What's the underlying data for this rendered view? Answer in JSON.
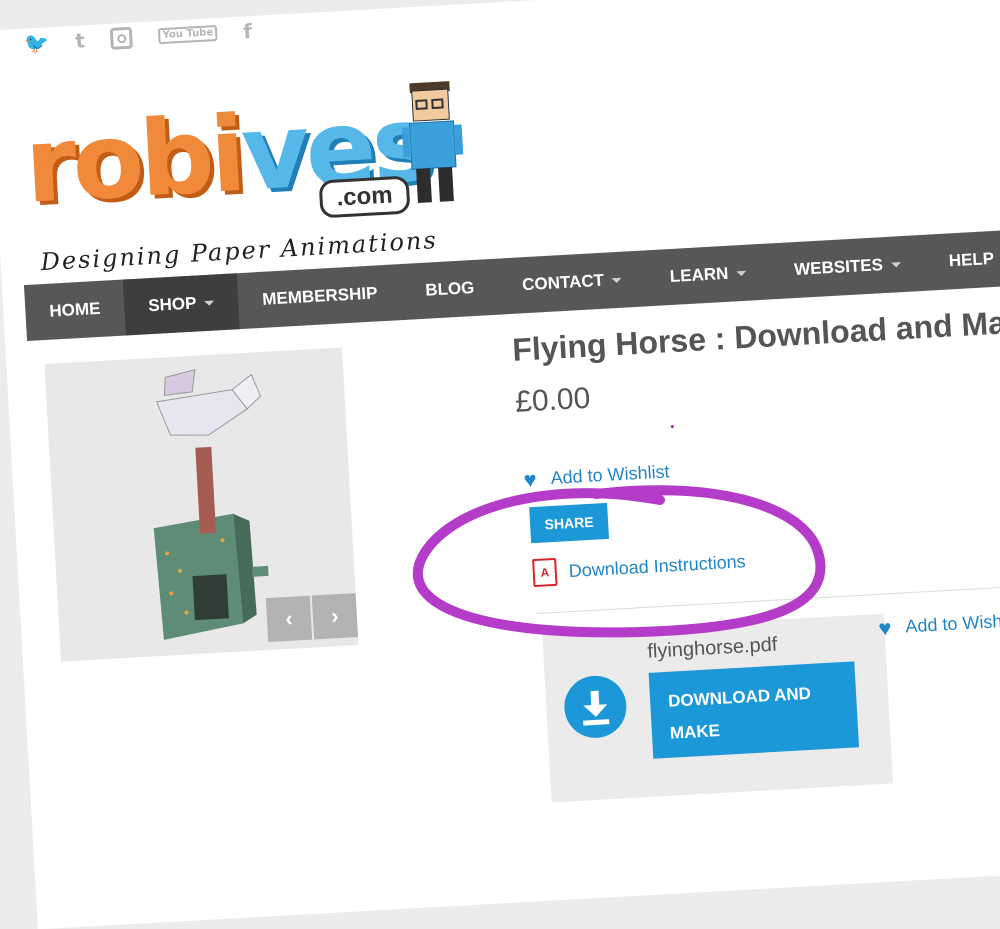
{
  "social": {
    "icons": [
      "twitter-icon",
      "tumblr-icon",
      "instagram-icon",
      "youtube-icon",
      "facebook-icon"
    ],
    "twitter_glyph": "🐦",
    "tumblr_glyph": "t",
    "youtube_glyph": "You Tube",
    "facebook_glyph": "f"
  },
  "logo": {
    "word_part1": "robi",
    "word_part2": "ves",
    "bubble": ".com",
    "tagline": "Designing Paper Animations"
  },
  "nav": {
    "items": [
      {
        "label": "HOME"
      },
      {
        "label": "SHOP"
      },
      {
        "label": "MEMBERSHIP"
      },
      {
        "label": "BLOG"
      },
      {
        "label": "CONTACT"
      },
      {
        "label": "LEARN"
      },
      {
        "label": "WEBSITES"
      },
      {
        "label": "HELP"
      }
    ],
    "active": "SHOP"
  },
  "gallery": {
    "prev": "‹",
    "next": "›"
  },
  "product": {
    "title": "Flying Horse : Download and Make",
    "price": "£0.00",
    "wishlist_label": "Add to Wishlist",
    "share_label": "SHARE",
    "download_instructions_label": "Download Instructions",
    "pdf_icon_glyph": "A"
  },
  "download_box": {
    "filename": "flyinghorse.pdf",
    "button_line1": "DOWNLOAD AND",
    "button_line2": "MAKE",
    "wishlist_label": "Add to Wishlis"
  },
  "colors": {
    "accent": "#1c98d8",
    "nav_bg": "#575757",
    "annotation": "#b43cc8"
  }
}
